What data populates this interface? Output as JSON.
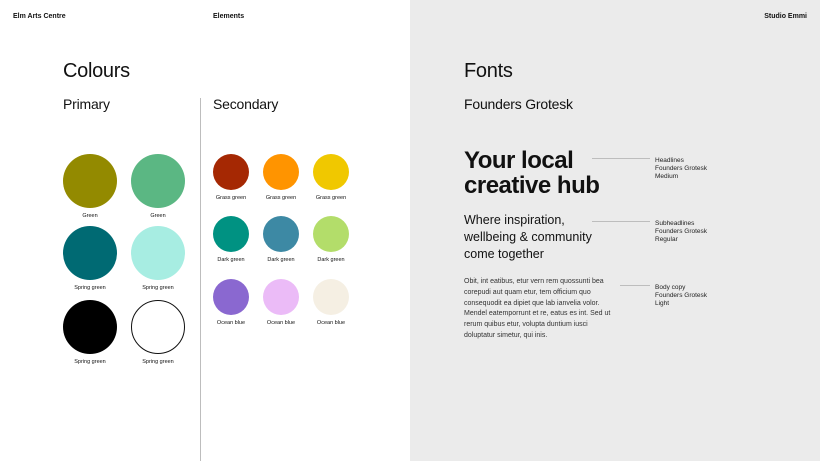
{
  "header": {
    "left": "Elm Arts Centre",
    "center": "Elements",
    "right": "Studio Emmi"
  },
  "colours": {
    "title": "Colours",
    "primary_title": "Primary",
    "secondary_title": "Secondary",
    "primary": [
      {
        "label": "Green",
        "color": "#938a00"
      },
      {
        "label": "Green",
        "color": "#5bb783"
      },
      {
        "label": "Spring green",
        "color": "#006a73"
      },
      {
        "label": "Spring green",
        "color": "#a7ede2"
      },
      {
        "label": "Spring green",
        "color": "#000000"
      },
      {
        "label": "Spring green",
        "color": "#ffffff"
      }
    ],
    "secondary": [
      {
        "label": "Grass green",
        "color": "#a52803"
      },
      {
        "label": "Grass green",
        "color": "#ff9400"
      },
      {
        "label": "Grass green",
        "color": "#f0c800"
      },
      {
        "label": "Dark green",
        "color": "#009282"
      },
      {
        "label": "Dark green",
        "color": "#3d89a4"
      },
      {
        "label": "Dark green",
        "color": "#b3dd6a"
      },
      {
        "label": "Ocean blue",
        "color": "#8a68d0"
      },
      {
        "label": "Ocean blue",
        "color": "#ebbbf7"
      },
      {
        "label": "Ocean blue",
        "color": "#f5efe3"
      }
    ]
  },
  "fonts": {
    "title": "Fonts",
    "family": "Founders Grotesk",
    "headline": [
      "Your local",
      "creative hub"
    ],
    "subheadline": [
      "Where inspiration,",
      "wellbeing & community",
      "come together"
    ],
    "body": "Obit, int eatibus, etur vern rem quossunti bea corepudi aut quam etur, tem officium quo consequodit ea dipiet que lab ianvelia volor. Mendel eatemporrunt et re, eatus es int. Sed ut rerum quibus etur, volupta duntium iusci doluptatur simetur, qui inis.",
    "notes": {
      "headline": [
        "Headlines",
        "Founders Grotesk",
        "Medium"
      ],
      "subheadline": [
        "Subheadlines",
        "Founders Grotesk",
        "Regular"
      ],
      "body": [
        "Body copy",
        "Founders Grotesk",
        "Light"
      ]
    }
  }
}
